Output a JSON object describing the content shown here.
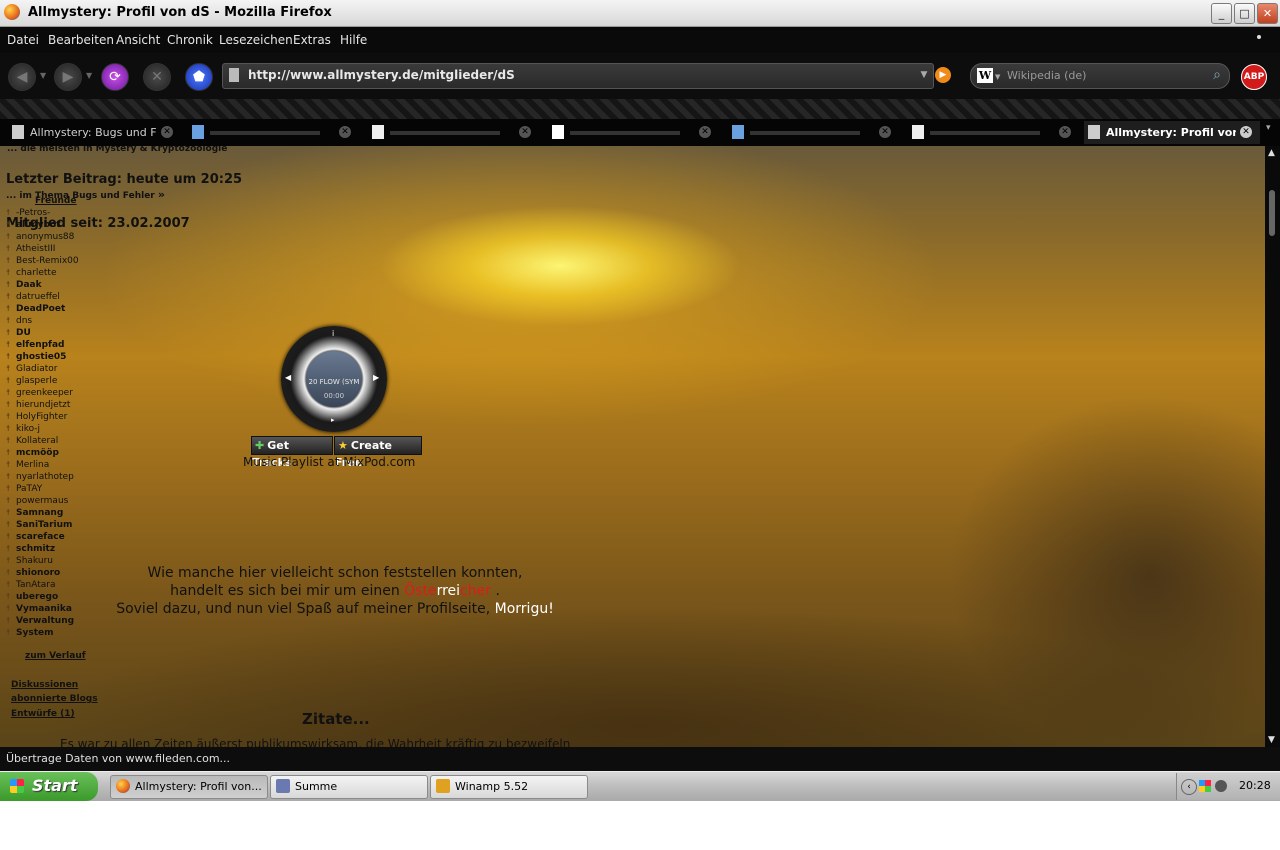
{
  "window": {
    "title": "Allmystery: Profil von dS - Mozilla Firefox",
    "btn_min": "_",
    "btn_max": "□",
    "btn_close": "✕"
  },
  "menu": {
    "items": [
      "Datei",
      "Bearbeiten",
      "Ansicht",
      "Chronik",
      "Lesezeichen",
      "Extras",
      "Hilfe"
    ]
  },
  "nav": {
    "url": "http://www.allmystery.de/mitglieder/dS",
    "search_placeholder": "Wikipedia (de)",
    "abp": "ABP"
  },
  "tabs": [
    {
      "label": "Allmystery: Bugs und F..."
    },
    {
      "label": ""
    },
    {
      "label": ""
    },
    {
      "label": ""
    },
    {
      "label": ""
    },
    {
      "label": ""
    },
    {
      "label": "Allmystery: Profil von..."
    }
  ],
  "page": {
    "top_line": "... die meisten in Mystery & Kryptozoologie",
    "last_post": "Letzter Beitrag: heute um 20:25",
    "last_post_thread": "... im Thema Bugs und Fehler",
    "friends_heading": "Freunde",
    "member_since": "Mitglied seit: 23.02.2007",
    "friends": [
      {
        "name": "-Petros-",
        "bold": false
      },
      {
        "name": "allmybot",
        "bold": true
      },
      {
        "name": "anonymus88",
        "bold": false
      },
      {
        "name": "AtheistIII",
        "bold": false
      },
      {
        "name": "Best-Remix00",
        "bold": false
      },
      {
        "name": "charlette",
        "bold": false
      },
      {
        "name": "Daak",
        "bold": true
      },
      {
        "name": "datrueffel",
        "bold": false
      },
      {
        "name": "DeadPoet",
        "bold": true
      },
      {
        "name": "dns",
        "bold": false
      },
      {
        "name": "DU",
        "bold": true
      },
      {
        "name": "elfenpfad",
        "bold": true
      },
      {
        "name": "ghostie05",
        "bold": true
      },
      {
        "name": "Gladiator",
        "bold": false
      },
      {
        "name": "glasperle",
        "bold": false
      },
      {
        "name": "greenkeeper",
        "bold": false
      },
      {
        "name": "hierundjetzt",
        "bold": false
      },
      {
        "name": "HolyFighter",
        "bold": false
      },
      {
        "name": "kiko-j",
        "bold": false
      },
      {
        "name": "Kollateral",
        "bold": false
      },
      {
        "name": "mcmööp",
        "bold": true
      },
      {
        "name": "Merlina",
        "bold": false
      },
      {
        "name": "nyarlathotep",
        "bold": false
      },
      {
        "name": "PaTAY",
        "bold": false
      },
      {
        "name": "powermaus",
        "bold": false
      },
      {
        "name": "Samnang",
        "bold": true
      },
      {
        "name": "SaniTarium",
        "bold": true
      },
      {
        "name": "scareface",
        "bold": true
      },
      {
        "name": "schmitz",
        "bold": true
      },
      {
        "name": "Shakuru",
        "bold": false
      },
      {
        "name": "shionoro",
        "bold": true
      },
      {
        "name": "TanAtara",
        "bold": false
      },
      {
        "name": "uberego",
        "bold": true
      },
      {
        "name": "Vymaanika",
        "bold": true
      },
      {
        "name": "Verwaltung",
        "bold": true
      },
      {
        "name": "System",
        "bold": true
      }
    ],
    "history_link": "zum Verlauf",
    "links": [
      "Diskussionen",
      "abonnierte Blogs",
      "Entwürfe (1)"
    ],
    "player": {
      "track": "20 FLOW (SYM",
      "time": "00:00",
      "get_tracks": "Get Tracks",
      "create_free": "Create Free",
      "caption": "Music Playlist at MixPod.com"
    },
    "intro_line1": "Wie manche hier vielleicht schon feststellen konnten,",
    "intro_line2_a": "handelt es sich bei mir um einen ",
    "intro_line2_b1": "Öste",
    "intro_line2_b2": "rrei",
    "intro_line2_b3": "cher",
    "intro_line2_c": " .",
    "intro_line3_a": "Soviel dazu, und nun viel Spaß auf meiner Profilseite, ",
    "intro_line3_b": "Morrigu!",
    "quotes_heading": "Zitate...",
    "quote_partial": "Es war zu allen Zeiten äußerst publikumswirksam, die Wahrheit kräftig zu bezweifeln"
  },
  "status": {
    "text": "Übertrage Daten von www.fileden.com..."
  },
  "taskbar": {
    "start": "Start",
    "tasks": [
      "Allmystery: Profil von...",
      "Summe",
      "Winamp 5.52"
    ],
    "clock": "20:28"
  }
}
